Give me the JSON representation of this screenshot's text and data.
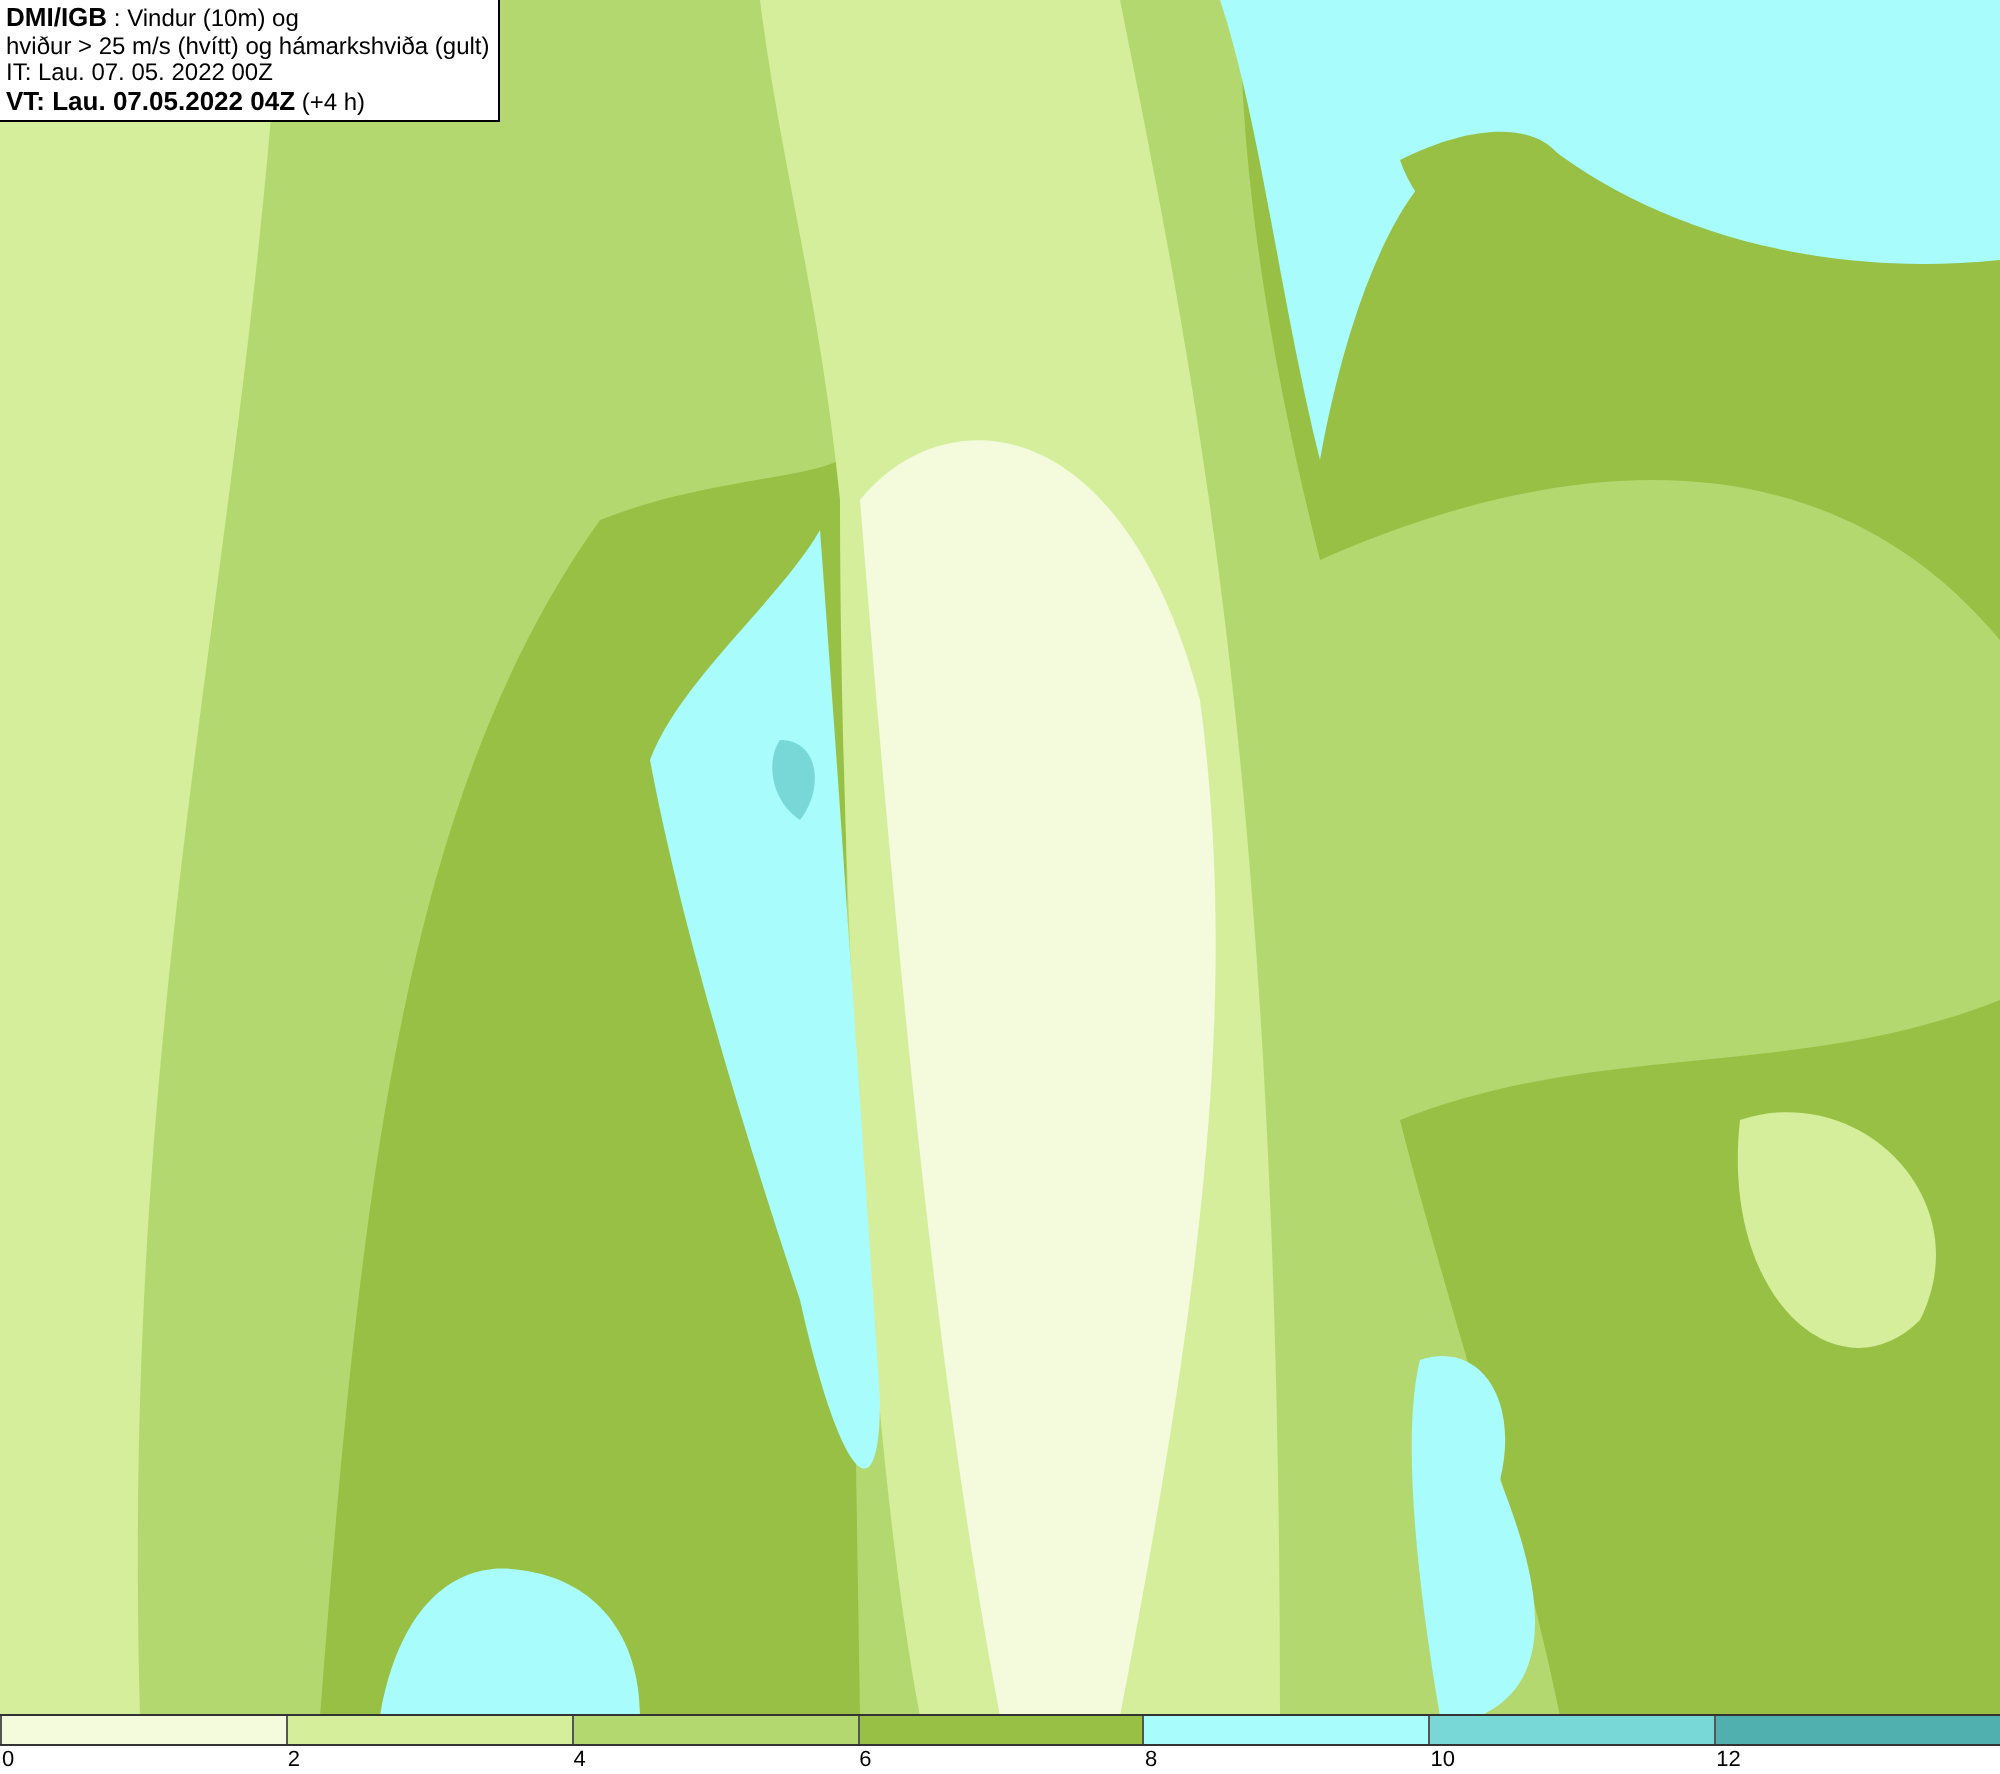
{
  "header": {
    "lines": [
      "**DMI/IGB** : Vindur (10m) og",
      "hviður > 25 m/s (hvítt) og hámarkshviða (gult)",
      "IT: Lau. 07. 05. 2022 00Z",
      "**VT: Lau. 07.05.2022 04Z** (+4 h)"
    ]
  },
  "legend": {
    "segments": [
      {
        "color": "#f4fadc"
      },
      {
        "color": "#d4ee9c"
      },
      {
        "color": "#b4d870"
      },
      {
        "color": "#98c044"
      },
      {
        "color": "#a8fcfc"
      },
      {
        "color": "#78d8d8"
      },
      {
        "color": "#50b0b0"
      }
    ],
    "labels": [
      "0",
      "2",
      "4",
      "6",
      "8",
      "10",
      "12"
    ]
  }
}
